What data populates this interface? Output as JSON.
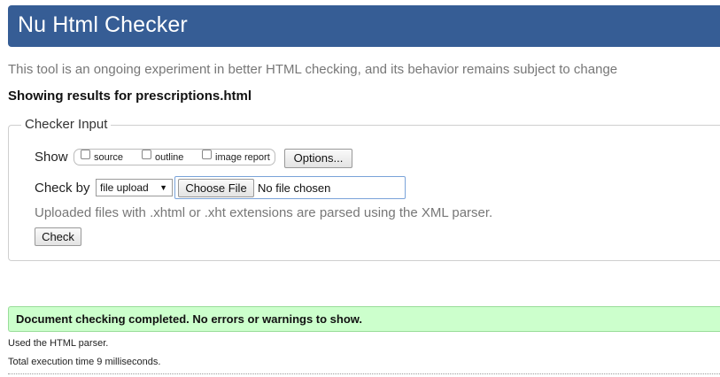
{
  "header": {
    "title": "Nu Html Checker"
  },
  "intro": {
    "text": "This tool is an ongoing experiment in better HTML checking, and its behavior remains subject to change"
  },
  "results_for": {
    "text": "Showing results for prescriptions.html"
  },
  "checker_input": {
    "legend": "Checker Input",
    "show_label": "Show",
    "show_options": [
      {
        "label": "source",
        "checked": false
      },
      {
        "label": "outline",
        "checked": false
      },
      {
        "label": "image report",
        "checked": false
      }
    ],
    "options_button": "Options...",
    "check_by_label": "Check by",
    "check_by_value": "file upload",
    "choose_file_button": "Choose File",
    "file_status": "No file chosen",
    "xml_note": "Uploaded files with .xhtml or .xht extensions are parsed using the XML parser.",
    "check_button": "Check"
  },
  "result": {
    "success_message": "Document checking completed. No errors or warnings to show.",
    "parser_note": "Used the HTML parser.",
    "timing_note": "Total execution time 9 milliseconds."
  },
  "colors": {
    "header_bg": "#365d95",
    "success_bg": "#ccffcc",
    "muted_text": "#777777"
  }
}
